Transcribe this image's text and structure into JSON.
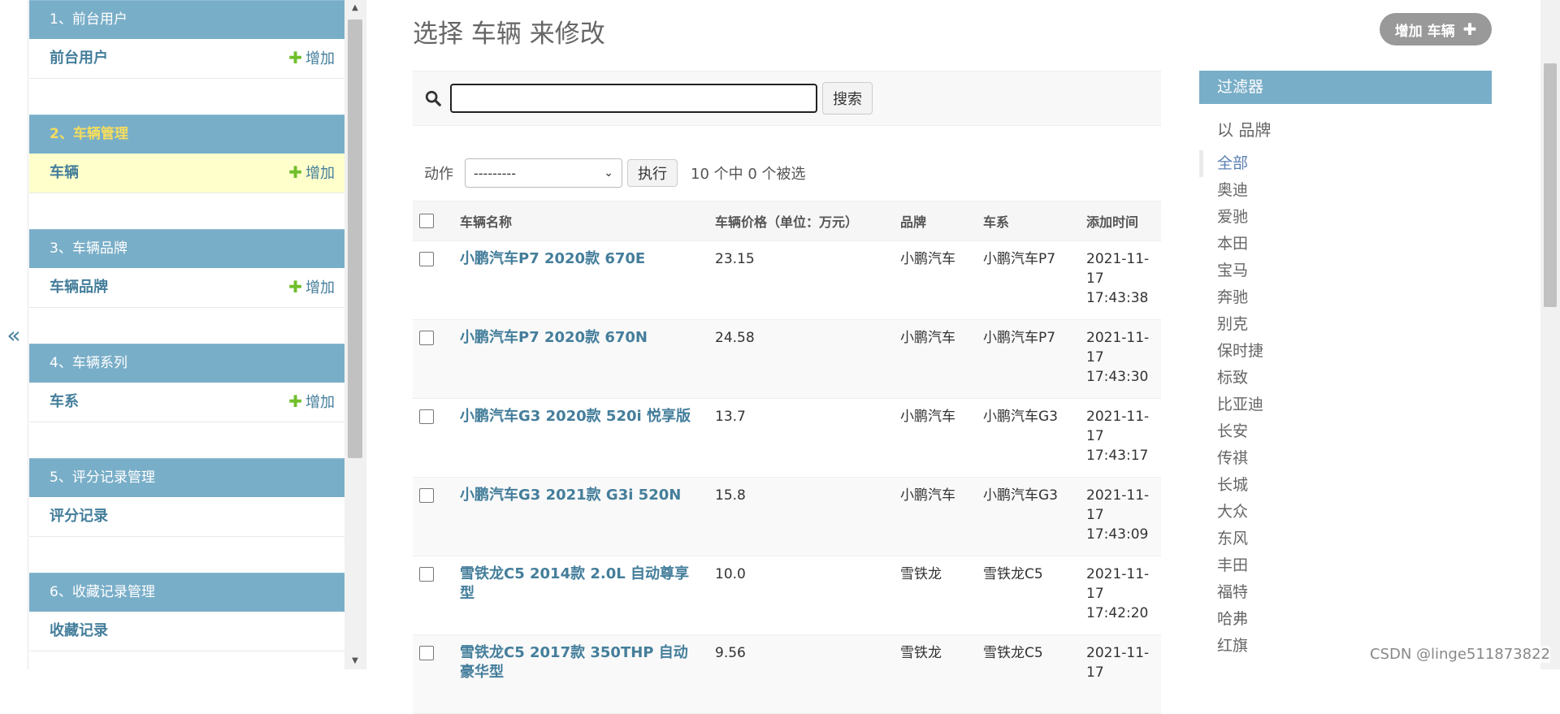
{
  "nav_toggle": "«",
  "sidebar": {
    "modules": [
      {
        "caption": "1、前台用户",
        "current": false,
        "models": [
          {
            "name": "前台用户",
            "add": "增加",
            "selected": false
          }
        ]
      },
      {
        "caption": "2、车辆管理",
        "current": true,
        "models": [
          {
            "name": "车辆",
            "add": "增加",
            "selected": true
          }
        ]
      },
      {
        "caption": "3、车辆品牌",
        "current": false,
        "models": [
          {
            "name": "车辆品牌",
            "add": "增加",
            "selected": false
          }
        ]
      },
      {
        "caption": "4、车辆系列",
        "current": false,
        "models": [
          {
            "name": "车系",
            "add": "增加",
            "selected": false
          }
        ]
      },
      {
        "caption": "5、评分记录管理",
        "current": false,
        "models": [
          {
            "name": "评分记录",
            "add": "",
            "selected": false
          }
        ]
      },
      {
        "caption": "6、收藏记录管理",
        "current": false,
        "models": [
          {
            "name": "收藏记录",
            "add": "",
            "selected": false
          }
        ]
      }
    ]
  },
  "page": {
    "title": "选择 车辆 来修改",
    "add_button": "增加 车辆"
  },
  "search": {
    "value": "",
    "button": "搜索"
  },
  "actions": {
    "label": "动作",
    "selected": "---------",
    "go_button": "执行",
    "counter": "10 个中 0 个被选"
  },
  "table": {
    "headers": [
      "车辆名称",
      "车辆价格（单位：万元）",
      "品牌",
      "车系",
      "添加时间"
    ],
    "rows": [
      {
        "name": "小鹏汽车P7 2020款 670E",
        "price": "23.15",
        "brand": "小鹏汽车",
        "series": "小鹏汽车P7",
        "date": "2021-11-",
        "date2": "17",
        "time": "17:43:38"
      },
      {
        "name": "小鹏汽车P7 2020款 670N",
        "price": "24.58",
        "brand": "小鹏汽车",
        "series": "小鹏汽车P7",
        "date": "2021-11-",
        "date2": "17",
        "time": "17:43:30"
      },
      {
        "name": "小鹏汽车G3 2020款 520i 悦享版",
        "price": "13.7",
        "brand": "小鹏汽车",
        "series": "小鹏汽车G3",
        "date": "2021-11-",
        "date2": "17",
        "time": "17:43:17"
      },
      {
        "name": "小鹏汽车G3 2021款 G3i 520N",
        "price": "15.8",
        "brand": "小鹏汽车",
        "series": "小鹏汽车G3",
        "date": "2021-11-",
        "date2": "17",
        "time": "17:43:09"
      },
      {
        "name": "雪铁龙C5 2014款 2.0L 自动尊享型",
        "price": "10.0",
        "brand": "雪铁龙",
        "series": "雪铁龙C5",
        "date": "2021-11-",
        "date2": "17",
        "time": "17:42:20"
      },
      {
        "name": "雪铁龙C5 2017款 350THP 自动豪华型",
        "price": "9.56",
        "brand": "雪铁龙",
        "series": "雪铁龙C5",
        "date": "2021-11-",
        "date2": "17",
        "time": ""
      }
    ]
  },
  "filter": {
    "header": "过滤器",
    "by": "以 品牌",
    "options": [
      "全部",
      "奥迪",
      "爱驰",
      "本田",
      "宝马",
      "奔驰",
      "别克",
      "保时捷",
      "标致",
      "比亚迪",
      "长安",
      "传祺",
      "长城",
      "大众",
      "东风",
      "丰田",
      "福特",
      "哈弗",
      "红旗"
    ],
    "selected_index": 0
  },
  "watermark": "CSDN @linge511873822",
  "colors": {
    "module_caption": "#79aec8",
    "link": "#447e9b",
    "current_caption_text": "#f5dd5d",
    "selected_row": "#ffffcc",
    "add_plus": "#70bf2b"
  },
  "icons": {
    "search": "search-icon",
    "add": "plus-icon",
    "collapse": "double-chevron-left-icon"
  }
}
